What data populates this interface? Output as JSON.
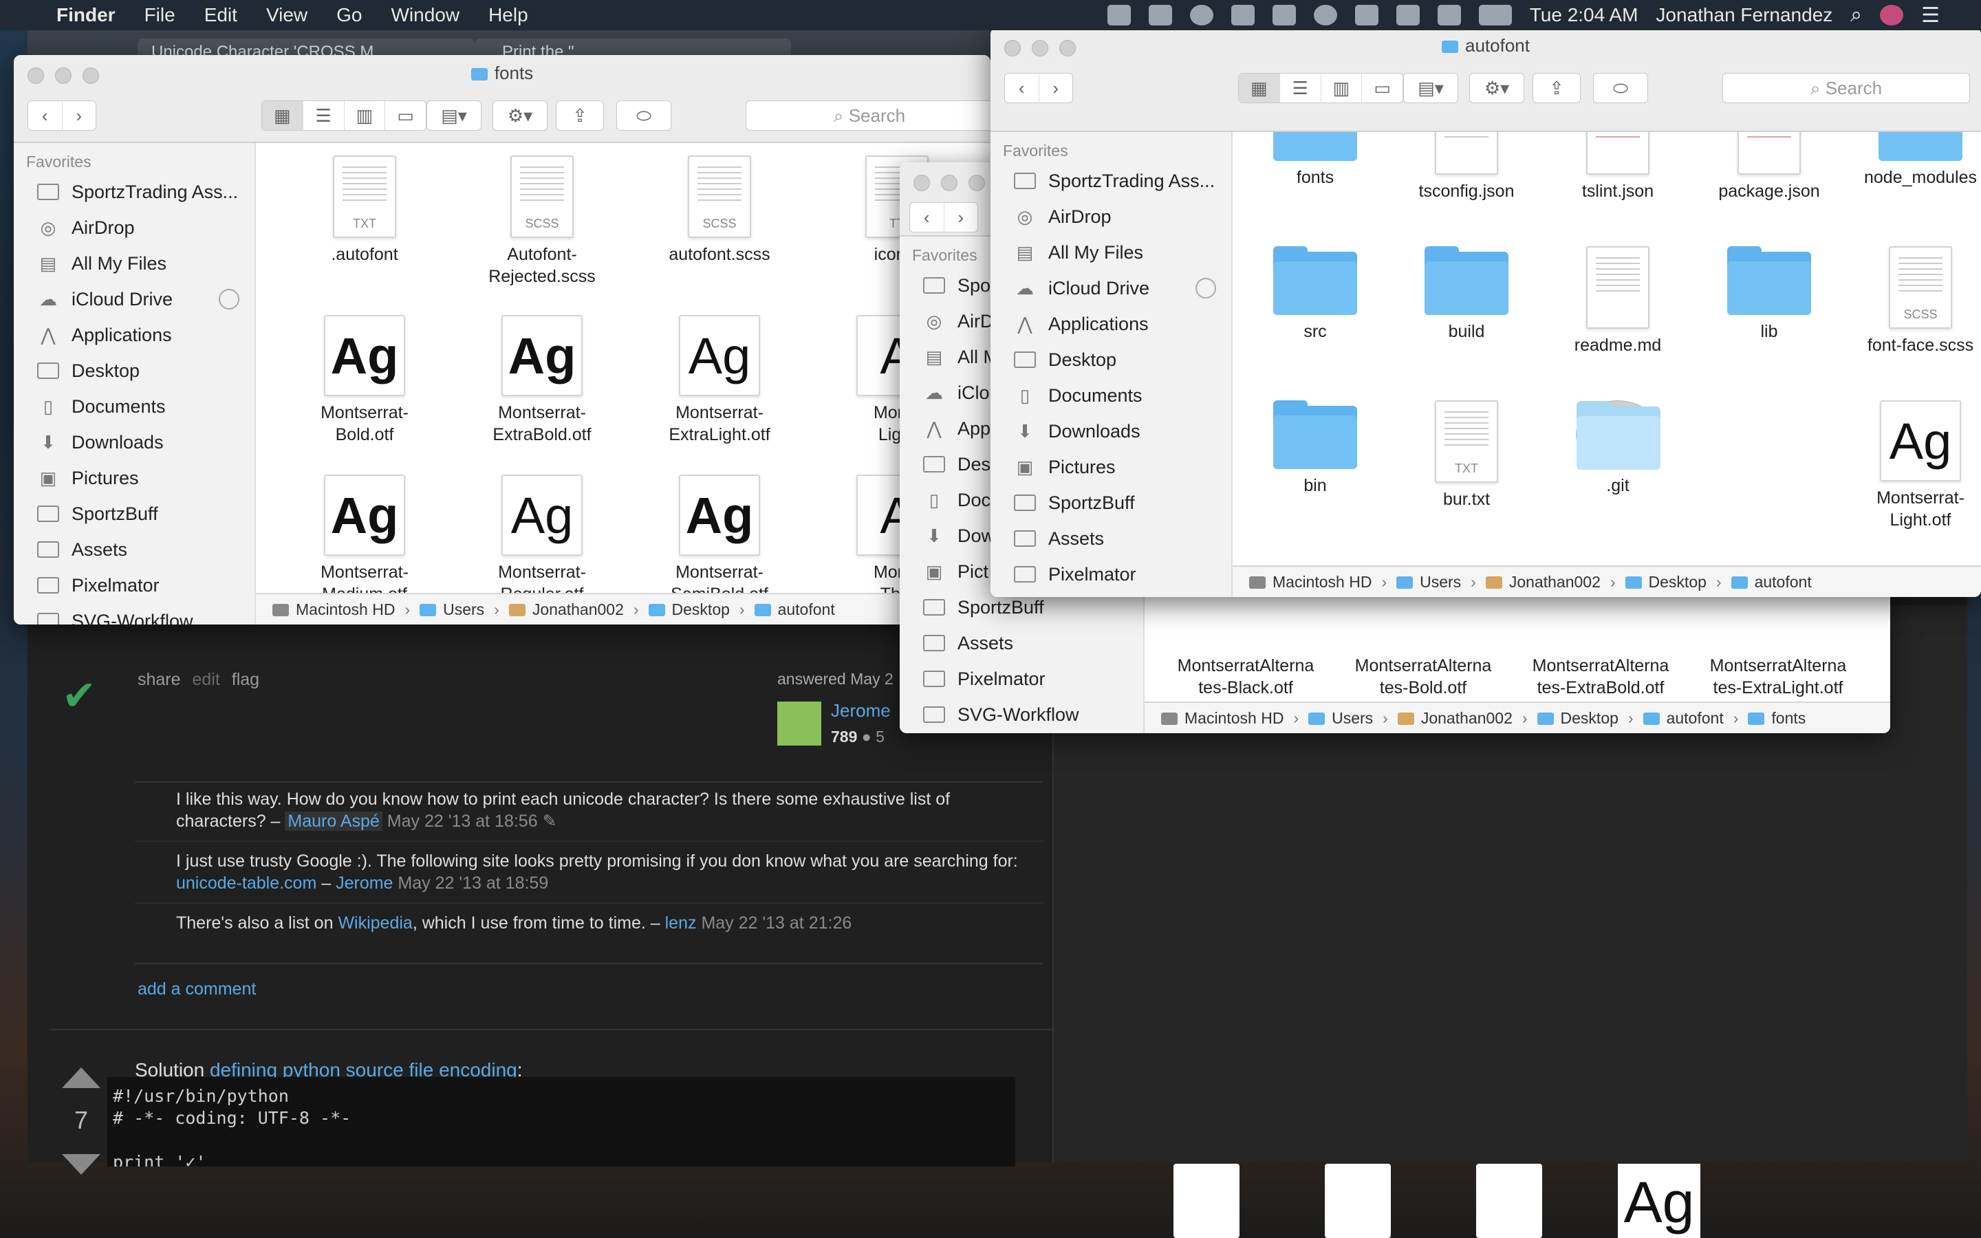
{
  "menubar": {
    "app_name": "Finder",
    "menus": [
      "File",
      "Edit",
      "View",
      "Go",
      "Window",
      "Help"
    ],
    "clock": "Tue 2:04 AM",
    "user": "Jonathan Fernandez"
  },
  "browser": {
    "tabs": [
      "Unicode Character 'CROSS M...",
      "...Print the \"..."
    ],
    "answer": {
      "actions": [
        "share",
        "edit",
        "flag"
      ],
      "answered": "answered May 2",
      "user": "Jerome",
      "rep": "789",
      "badges": "5",
      "comments": [
        {
          "text": "I like this way. How do you know how to print each unicode character? Is there some exhaustive list of characters? –",
          "user": "Mauro Aspé",
          "date": "May 22 '13 at 18:56"
        },
        {
          "text_a": "I just use trusty Google :). The following site looks pretty promising if you don know what you are searching for:",
          "link": "unicode-table.com",
          "user": "Jerome",
          "date": "May 22 '13 at 18:59"
        },
        {
          "text_a": "There's also a list on",
          "link": "Wikipedia",
          "text_b": ", which I use from time to time. –",
          "user": "lenz",
          "date": "May 22 '13 at 21:26"
        }
      ],
      "add_comment": "add a comment"
    },
    "next_answer": {
      "votes": "7",
      "intro": "Solution",
      "link": "defining python source file encoding",
      "code": "#!/usr/bin/python\n# -*- coding: UTF-8 -*-\n\nprint '✓'"
    }
  },
  "finder_fonts": {
    "title": "fonts",
    "search_placeholder": "Search",
    "sidebar_heading": "Favorites",
    "sidebar": [
      "SportzTrading Ass...",
      "AirDrop",
      "All My Files",
      "iCloud Drive",
      "Applications",
      "Desktop",
      "Documents",
      "Downloads",
      "Pictures",
      "SportzBuff",
      "Assets",
      "Pixelmator",
      "SVG-Workflow"
    ],
    "files": [
      {
        "name": ".autofont",
        "kind": "doc",
        "ext": "TXT"
      },
      {
        "name": "Autofont-\nRejected.scss",
        "kind": "doc",
        "ext": "SCSS"
      },
      {
        "name": "autofont.scss",
        "kind": "doc",
        "ext": "SCSS"
      },
      {
        "name": "icomo",
        "kind": "doc",
        "ext": "TT"
      },
      {
        "name": "Montserrat-\nBold.otf",
        "kind": "font",
        "glyph": "Ag"
      },
      {
        "name": "Montserrat-\nExtraBold.otf",
        "kind": "font",
        "glyph": "Ag"
      },
      {
        "name": "Montserrat-\nExtraLight.otf",
        "kind": "font",
        "glyph": "Ag"
      },
      {
        "name": "Monts\nLight",
        "kind": "font",
        "glyph": "A"
      },
      {
        "name": "Montserrat-\nMedium.otf",
        "kind": "font",
        "glyph": "Ag"
      },
      {
        "name": "Montserrat-\nRegular.otf",
        "kind": "font",
        "glyph": "Ag"
      },
      {
        "name": "Montserrat-\nSemiBold.otf",
        "kind": "font",
        "glyph": "Ag"
      },
      {
        "name": "Monts\nThin",
        "kind": "font",
        "glyph": "A"
      }
    ],
    "path": [
      "Macintosh HD",
      "Users",
      "Jonathan002",
      "Desktop",
      "autofont"
    ]
  },
  "finder_middle": {
    "sidebar_heading": "Favorites",
    "sidebar": [
      "Spo",
      "AirD",
      "All M",
      "iClo",
      "App",
      "Des",
      "Doc",
      "Dow",
      "Pict",
      "SportzBuff",
      "Assets",
      "Pixelmator",
      "SVG-Workflow"
    ],
    "files": [
      {
        "name": "MontserratAlterna\ntes-Black.otf"
      },
      {
        "name": "MontserratAlterna\ntes-Bold.otf"
      },
      {
        "name": "MontserratAlterna\ntes-ExtraBold.otf"
      },
      {
        "name": "MontserratAlterna\ntes-ExtraLight.otf"
      }
    ],
    "path": [
      "Macintosh HD",
      "Users",
      "Jonathan002",
      "Desktop",
      "autofont",
      "fonts"
    ]
  },
  "finder_autofont": {
    "title": "autofont",
    "search_placeholder": "Search",
    "sidebar_heading": "Favorites",
    "sidebar": [
      "SportzTrading Ass...",
      "AirDrop",
      "All My Files",
      "iCloud Drive",
      "Applications",
      "Desktop",
      "Documents",
      "Downloads",
      "Pictures",
      "SportzBuff",
      "Assets",
      "Pixelmator",
      "SVG-Workflow"
    ],
    "files": [
      {
        "name": "fonts",
        "kind": "folder"
      },
      {
        "name": "tsconfig.json",
        "kind": "doc"
      },
      {
        "name": "tslint.json",
        "kind": "doc",
        "red": true
      },
      {
        "name": "package.json",
        "kind": "doc",
        "red": true
      },
      {
        "name": "node_modules",
        "kind": "folder"
      },
      {
        "name": "src",
        "kind": "folder"
      },
      {
        "name": "build",
        "kind": "folder"
      },
      {
        "name": "readme.md",
        "kind": "doc"
      },
      {
        "name": "lib",
        "kind": "folder"
      },
      {
        "name": "font-face.scss",
        "kind": "doc",
        "ext": "SCSS"
      },
      {
        "name": "bin",
        "kind": "folder"
      },
      {
        "name": "bur.txt",
        "kind": "doc",
        "ext": "TXT"
      },
      {
        "name": ".git",
        "kind": "folder-light"
      },
      {
        "name": "",
        "kind": "none"
      },
      {
        "name": "Montserrat-\nLight.otf",
        "kind": "font",
        "glyph": "Ag"
      }
    ],
    "path": [
      "Macintosh HD",
      "Users",
      "Jonathan002",
      "Desktop",
      "autofont"
    ]
  },
  "dock": {
    "glyph": "Ag"
  }
}
